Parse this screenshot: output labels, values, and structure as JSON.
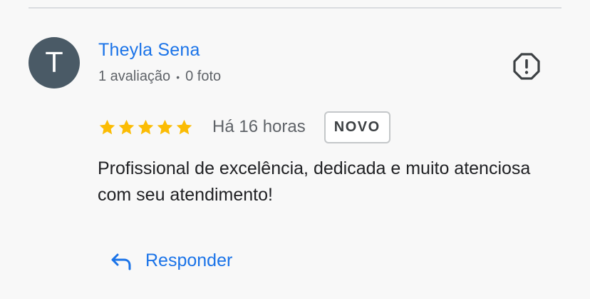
{
  "review": {
    "author_initial": "T",
    "author_name": "Theyla Sena",
    "review_count": "1 avaliação",
    "separator": "•",
    "photo_count": "0 foto",
    "rating": 5,
    "rating_max": 5,
    "time_ago": "Há 16 horas",
    "badge": "NOVO",
    "text": "Profissional de excelência, dedicada e muito atenciosa com seu atendimento!",
    "reply_label": "Responder"
  },
  "colors": {
    "accent": "#1a73e8",
    "star": "#fbbc04",
    "avatar_bg": "#4a5a66"
  },
  "icons": {
    "report": "report-octagon-icon",
    "reply": "reply-arrow-icon",
    "star": "star-icon"
  }
}
